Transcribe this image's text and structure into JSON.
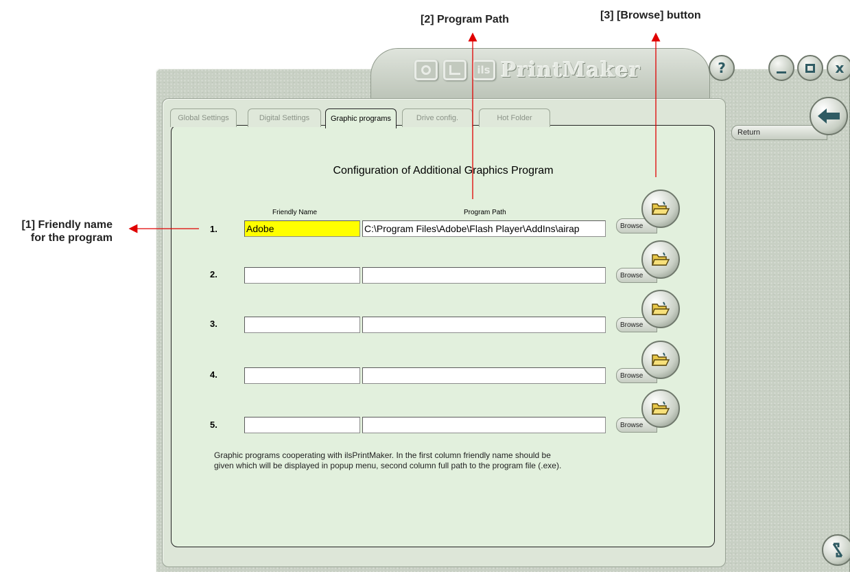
{
  "annotations": {
    "friendly_name": "[1] Friendly name for the program",
    "program_path": "[2] Program Path",
    "browse_button": "[3] [Browse] button"
  },
  "window": {
    "title": "PrintMaker",
    "logo_text": "ils",
    "controls": {
      "help": "?",
      "close": "x"
    }
  },
  "sidebar": {
    "return_label": "Return"
  },
  "tabs": [
    {
      "label": "Global Settings",
      "active": false
    },
    {
      "label": "Digital Settings",
      "active": false
    },
    {
      "label": "Graphic programs",
      "active": true
    },
    {
      "label": "Drive config.",
      "active": false
    },
    {
      "label": "Hot Folder",
      "active": false
    }
  ],
  "main": {
    "section_title": "Configuration of Additional Graphics Program",
    "column_headers": {
      "friendly_name": "Friendly Name",
      "program_path": "Program Path"
    },
    "rows": [
      {
        "num": "1.",
        "friendly_name": "Adobe",
        "program_path": "C:\\Program Files\\Adobe\\Flash Player\\AddIns\\airap",
        "browse_label": "Browse"
      },
      {
        "num": "2.",
        "friendly_name": "",
        "program_path": "",
        "browse_label": "Browse"
      },
      {
        "num": "3.",
        "friendly_name": "",
        "program_path": "",
        "browse_label": "Browse"
      },
      {
        "num": "4.",
        "friendly_name": "",
        "program_path": "",
        "browse_label": "Browse"
      },
      {
        "num": "5.",
        "friendly_name": "",
        "program_path": "",
        "browse_label": "Browse"
      }
    ],
    "help_text_line1": "Graphic programs cooperating with ilsPrintMaker. In the first column friendly name  should be",
    "help_text_line2": "given which will be displayed in popup menu, second column full path to the program file (.exe)."
  },
  "colors": {
    "highlight": "#ffff00",
    "annotation_arrow": "#e00000",
    "content_bg": "#e2f0dd",
    "accent_icon": "#2f5b63"
  },
  "icons": {
    "browse": "folder-open-icon",
    "return": "arrow-left-icon",
    "corner": "resize-icon"
  }
}
